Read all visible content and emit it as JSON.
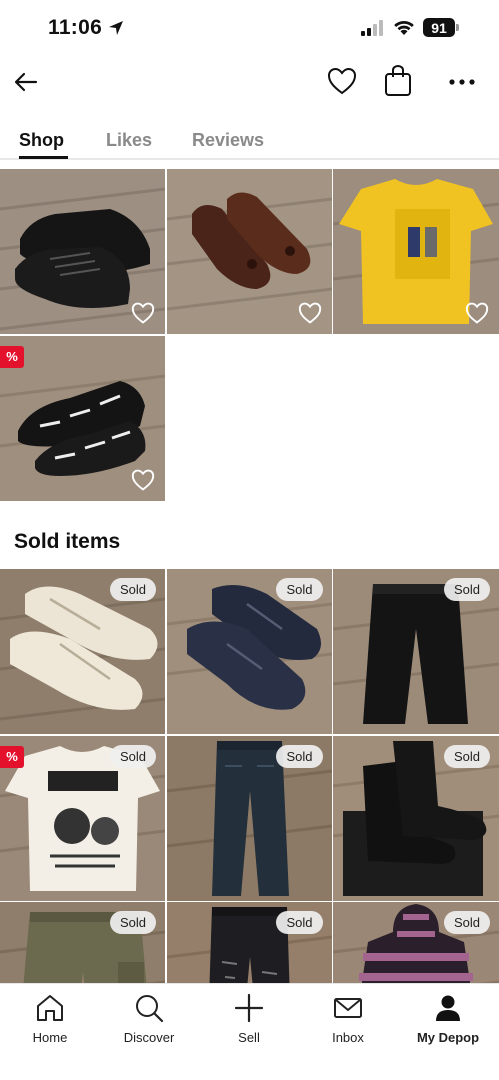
{
  "status_bar": {
    "time": "11:06",
    "battery": "91"
  },
  "header": {
    "back_icon": "back-arrow-icon",
    "like_icon": "heart-icon",
    "bag_icon": "shopping-bag-icon",
    "more_icon": "more-dots-icon"
  },
  "tabs": [
    {
      "label": "Shop",
      "active": true
    },
    {
      "label": "Likes",
      "active": false
    },
    {
      "label": "Reviews",
      "active": false
    }
  ],
  "shop_items": [
    {
      "name": "black-sneakers",
      "sale": false
    },
    {
      "name": "brown-tassel-loafers",
      "sale": false
    },
    {
      "name": "yellow-graphic-tshirt",
      "sale": false
    },
    {
      "name": "black-white-print-sneakers",
      "sale": true,
      "sale_label": "%"
    }
  ],
  "sold_section": {
    "title": "Sold items",
    "badge": "Sold",
    "items": [
      {
        "name": "cream-retro-sneakers",
        "sale": false
      },
      {
        "name": "navy-leather-shoes",
        "sale": false
      },
      {
        "name": "black-trousers",
        "sale": false
      },
      {
        "name": "white-graphic-tshirt",
        "sale": true,
        "sale_label": "%"
      },
      {
        "name": "dark-denim-jeans",
        "sale": false
      },
      {
        "name": "black-leather-boots",
        "sale": false
      },
      {
        "name": "olive-cargo-shorts",
        "sale": false
      },
      {
        "name": "black-distressed-jeans",
        "sale": false
      },
      {
        "name": "striped-hoodie",
        "sale": false
      }
    ]
  },
  "bottom_nav": [
    {
      "label": "Home",
      "icon": "home-icon"
    },
    {
      "label": "Discover",
      "icon": "search-icon"
    },
    {
      "label": "Sell",
      "icon": "plus-icon"
    },
    {
      "label": "Inbox",
      "icon": "mail-icon"
    },
    {
      "label": "My Depop",
      "icon": "profile-icon",
      "active": true
    }
  ],
  "colors": {
    "sale_badge": "#e4112d",
    "text": "#111111",
    "inactive_tab": "#8a8a8a"
  }
}
